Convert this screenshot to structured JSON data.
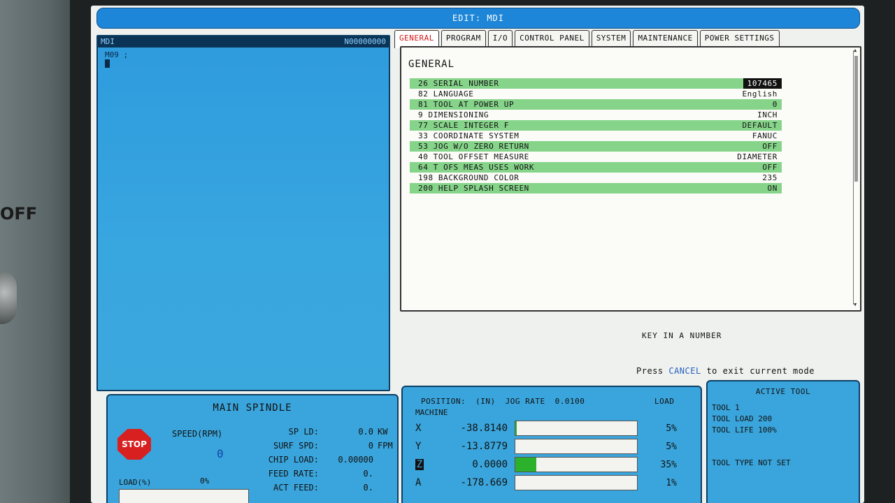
{
  "bezel": {
    "off_label": "OFF"
  },
  "title_bar": "EDIT: MDI",
  "mdi": {
    "header_left": "MDI",
    "header_right": "N00000000",
    "program_line": "M09 ;"
  },
  "tabs": [
    "GENERAL",
    "PROGRAM",
    "I/O",
    "CONTROL PANEL",
    "SYSTEM",
    "MAINTENANCE",
    "POWER SETTINGS"
  ],
  "settings": {
    "title": "GENERAL",
    "rows": [
      {
        "label": "26 SERIAL NUMBER",
        "value": "107465",
        "shaded": true,
        "selected": true
      },
      {
        "label": "82 LANGUAGE",
        "value": "English",
        "shaded": false
      },
      {
        "label": "81 TOOL AT POWER UP",
        "value": "0",
        "shaded": true
      },
      {
        "label": " 9 DIMENSIONING",
        "value": "INCH",
        "shaded": false
      },
      {
        "label": "77 SCALE INTEGER F",
        "value": "DEFAULT",
        "shaded": true
      },
      {
        "label": "33 COORDINATE SYSTEM",
        "value": "FANUC",
        "shaded": false
      },
      {
        "label": "53 JOG W/O ZERO RETURN",
        "value": "OFF",
        "shaded": true
      },
      {
        "label": "40 TOOL OFFSET MEASURE",
        "value": "DIAMETER",
        "shaded": false
      },
      {
        "label": "64 T OFS MEAS USES WORK",
        "value": "OFF",
        "shaded": true
      },
      {
        "label": "198 BACKGROUND COLOR",
        "value": "235",
        "shaded": false
      },
      {
        "label": "200 HELP SPLASH SCREEN",
        "value": "ON",
        "shaded": true
      }
    ]
  },
  "prompt": "KEY IN A NUMBER",
  "hint": {
    "before": "Press ",
    "key": "CANCEL",
    "after": " to exit current mode"
  },
  "spindle": {
    "title": "MAIN SPINDLE",
    "stop_label": "STOP",
    "speed_label": "SPEED(RPM)",
    "speed_value": "0",
    "load_label": "LOAD(%)",
    "load_value": "0%",
    "load_fraction": 0,
    "stats": [
      {
        "label": "SP LD:",
        "value": "0.0",
        "unit": "KW"
      },
      {
        "label": "SURF SPD:",
        "value": "0",
        "unit": "FPM"
      },
      {
        "label": "CHIP LOAD:",
        "value": "0.00000",
        "unit": ""
      },
      {
        "label": "FEED RATE:",
        "value": "0.",
        "unit": ""
      },
      {
        "label": "ACT FEED:",
        "value": "0.",
        "unit": ""
      }
    ]
  },
  "position": {
    "label": "POSITION:",
    "units": "(IN)",
    "jog_label": "JOG RATE",
    "jog_value": "0.0100",
    "load_label": "LOAD",
    "mode": "MACHINE",
    "axes": [
      {
        "name": "X",
        "value": "-38.8140",
        "load": "5%",
        "load_fraction": 0.01,
        "boxed": false
      },
      {
        "name": "Y",
        "value": "-13.8779",
        "load": "5%",
        "load_fraction": 0.0,
        "boxed": false
      },
      {
        "name": "Z",
        "value": "0.0000",
        "load": "35%",
        "load_fraction": 0.17,
        "boxed": true
      },
      {
        "name": "A",
        "value": "-178.669",
        "load": "1%",
        "load_fraction": 0.0,
        "boxed": false
      }
    ]
  },
  "active_tool": {
    "title": "ACTIVE TOOL",
    "lines": [
      "TOOL 1",
      "TOOL LOAD 200",
      "TOOL LIFE 100%"
    ],
    "type_line": "TOOL TYPE NOT SET"
  },
  "colors": {
    "title_bar": "#1e86d8",
    "panel_blue": "#3aa5dc",
    "row_green": "#86d48a",
    "active_tab_text": "#d21818",
    "cancel_text": "#2860c0",
    "stop_red": "#d82020"
  }
}
